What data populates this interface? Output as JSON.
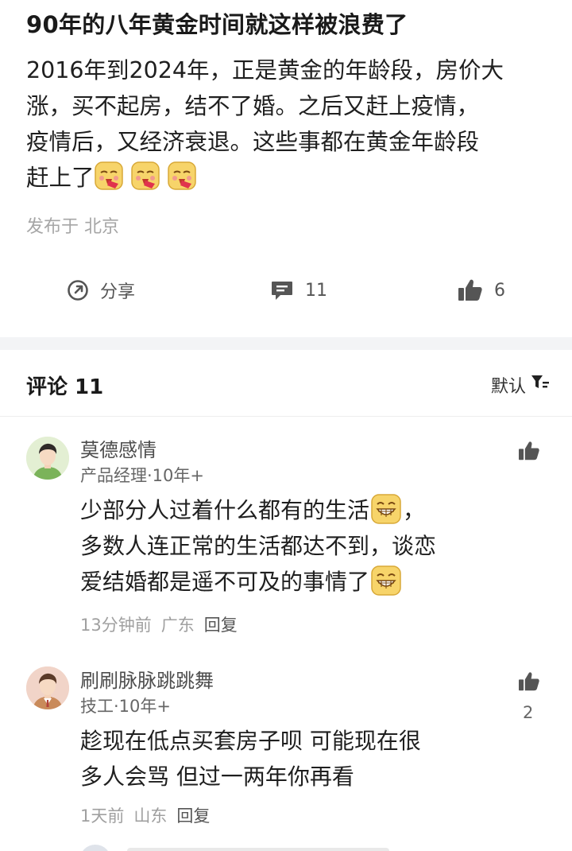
{
  "post": {
    "title": "90年的八年黄金时间就这样被浪费了",
    "body_lines": [
      "2016年到2024年，正是黄金的年龄段，房价大",
      "涨，买不起房，结不了婚。之后又赶上疫情，",
      "疫情后，又经济衰退。这些事都在黄金年龄段",
      "赶上了"
    ],
    "emoji_icon": "blushing-laugh-emoji",
    "location": "发布于 北京",
    "actions": {
      "share_label": "分享",
      "comment_count": "11",
      "like_count": "6"
    }
  },
  "comments_section": {
    "title": "评论 11",
    "sort_label": "默认"
  },
  "comments": [
    {
      "name": "莫德感情",
      "meta": "产品经理·10年+",
      "text_lines": [
        "少部分人过着什么都有的生活",
        "，",
        "多数人连正常的生活都达不到，谈恋",
        "爱结婚都是遥不可及的事情了"
      ],
      "time": "13分钟前",
      "location": "广东",
      "reply_label": "回复",
      "like_count": ""
    },
    {
      "name": "刷刷脉脉跳跳舞",
      "meta": "技工·10年+",
      "text_lines": [
        "趁现在低点买套房子呗 可能现在很",
        "多人会骂 但过一两年你再看"
      ],
      "time": "1天前",
      "location": "山东",
      "reply_label": "回复",
      "like_count": "2"
    }
  ],
  "colors": {
    "text_primary": "#1a1a1a",
    "text_secondary": "#a6a6a6",
    "icon_gray": "#555555",
    "divider": "#f3f4f6"
  }
}
